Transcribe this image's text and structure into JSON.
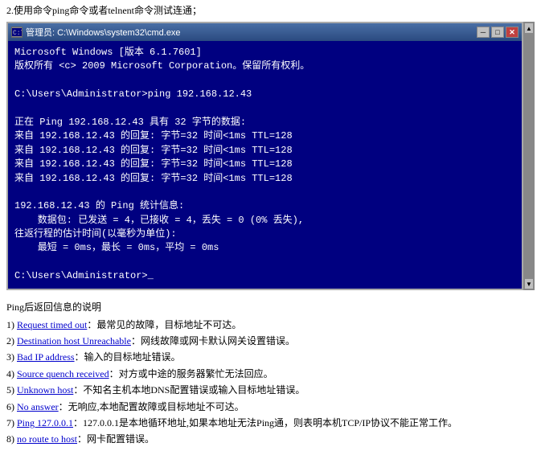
{
  "top_instruction": "2.使用命令ping命令或者telnent命令测试连通；",
  "cmd": {
    "titlebar": {
      "icon_label": "C:\\",
      "title": "管理员: C:\\Windows\\system32\\cmd.exe",
      "btn_min": "─",
      "btn_max": "□",
      "btn_close": "✕"
    },
    "lines": [
      {
        "text": "Microsoft Windows [版本 6.1.7601]",
        "style": "white"
      },
      {
        "text": "版权所有 (c) 2009 Microsoft Corporation。保留所有权利。",
        "style": "white"
      },
      {
        "text": "",
        "style": "white"
      },
      {
        "text": "C:\\Users\\Administrator>ping 192.168.12.43",
        "style": "white"
      },
      {
        "text": "",
        "style": "white"
      },
      {
        "text": "正在 Ping 192.168.12.43 具有 32 字节的数据:",
        "style": "white"
      },
      {
        "text": "来自 192.168.12.43 的回复: 字节=32 时间<1ms TTL=128",
        "style": "white"
      },
      {
        "text": "来自 192.168.12.43 的回复: 字节=32 时间<1ms TTL=128",
        "style": "white"
      },
      {
        "text": "来自 192.168.12.43 的回复: 字节=32 时间<1ms TTL=128",
        "style": "white"
      },
      {
        "text": "来自 192.168.12.43 的回复: 字节=32 时间<1ms TTL=128",
        "style": "white"
      },
      {
        "text": "",
        "style": "white"
      },
      {
        "text": "192.168.12.43 的 Ping 统计信息:",
        "style": "white"
      },
      {
        "text": "    数据包: 已发送 = 4，已接收 = 4，丢失 = 0 (0% 丢失),",
        "style": "white"
      },
      {
        "text": "往返行程的估计时间(以毫秒为单位):",
        "style": "white"
      },
      {
        "text": "    最短 = 0ms，最长 = 0ms，平均 = 0ms",
        "style": "white"
      },
      {
        "text": "",
        "style": "white"
      },
      {
        "text": "C:\\Users\\Administrator>_",
        "style": "white"
      }
    ]
  },
  "info": {
    "title": "Ping后返回信息的说明",
    "items": [
      {
        "number": "1)",
        "label": "Request timed out",
        "colon": "：",
        "desc": "最常见的故障，目标地址不可达。"
      },
      {
        "number": "2)",
        "label": "Destination host Unreachable",
        "colon": "：",
        "desc": "网线故障或网卡默认网关设置错误。"
      },
      {
        "number": "3)",
        "label": "Bad IP address",
        "colon": "：",
        "desc": "输入的目标地址错误。"
      },
      {
        "number": "4)",
        "label": "Source quench received",
        "colon": "：",
        "desc": "对方或中途的服务器繁忙无法回应。"
      },
      {
        "number": "5)",
        "label": "Unknown host",
        "colon": "：",
        "desc": "不知名主机本地DNS配置错误或输入目标地址错误。"
      },
      {
        "number": "6)",
        "label": "No answer",
        "colon": "：",
        "desc": "无响应,本地配置故障或目标地址不可达。"
      },
      {
        "number": "7)",
        "label": "Ping 127.0.0.1",
        "colon": "：",
        "desc": "127.0.0.1是本地循环地址,如果本地址无法Ping通，则表明本机TCP/IP协议不能正常工作。"
      },
      {
        "number": "8)",
        "label": "no route to host",
        "colon": "：",
        "desc": "网卡配置错误。"
      }
    ]
  }
}
